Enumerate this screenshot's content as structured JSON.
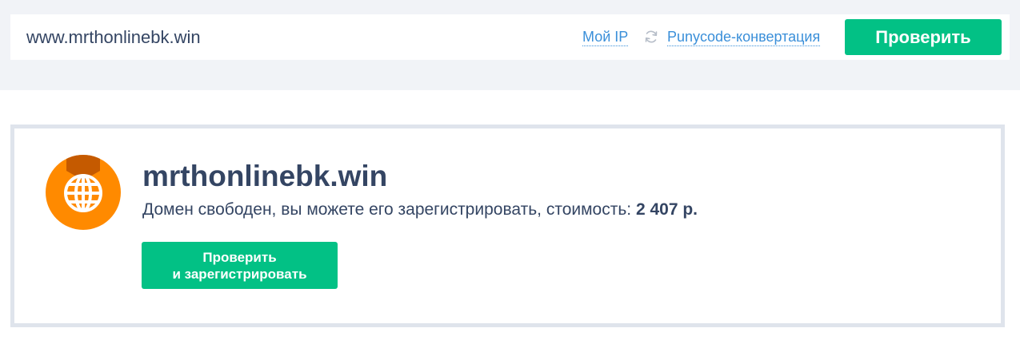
{
  "search": {
    "value": "www.mrthonlinebk.win",
    "my_ip_label": "Мой IP",
    "refresh_icon": "refresh-icon",
    "punycode_label": "Punycode-конвертация",
    "check_button_label": "Проверить"
  },
  "result": {
    "icon": "globe-icon",
    "domain": "mrthonlinebk.win",
    "status_text": "Домен свободен, вы можете его зарегистрировать, стоимость: ",
    "price": "2 407 р.",
    "register_button": {
      "line1": "Проверить",
      "line2": "и зарегистрировать"
    }
  },
  "colors": {
    "accent_green": "#02c185",
    "link_blue": "#3a8fd9",
    "badge_orange": "#ff8a00",
    "badge_dark_orange": "#c55a00",
    "text_dark": "#344563",
    "page_band": "#f1f3f7",
    "card_border": "#dfe4ec"
  }
}
